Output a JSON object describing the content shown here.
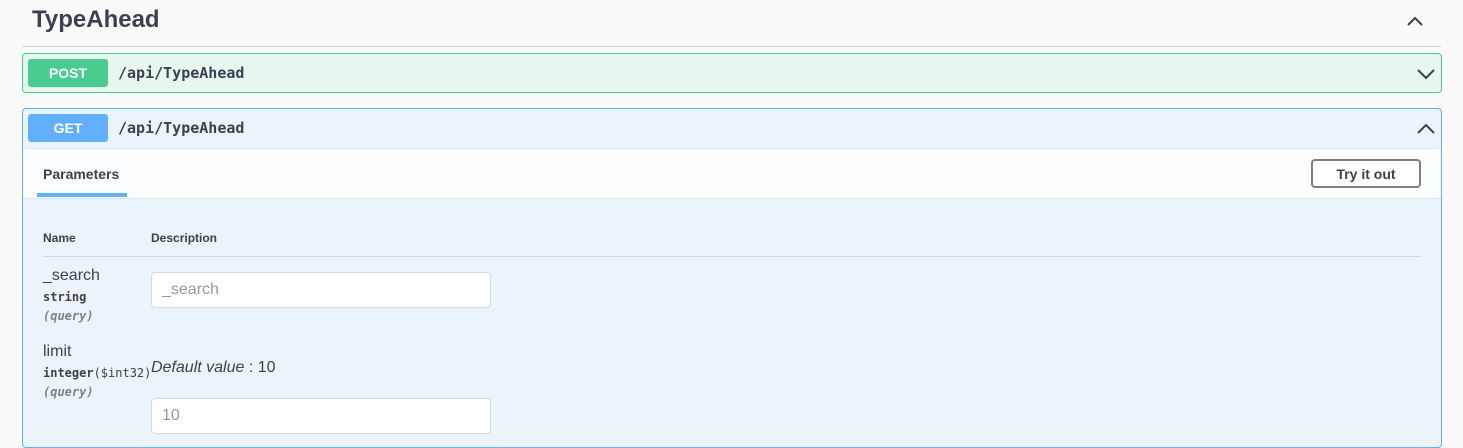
{
  "section": {
    "title": "TypeAhead"
  },
  "operations": [
    {
      "method": "POST",
      "path": "/api/TypeAhead"
    },
    {
      "method": "GET",
      "path": "/api/TypeAhead"
    }
  ],
  "panel": {
    "tab_label": "Parameters",
    "try_label": "Try it out",
    "col_name": "Name",
    "col_description": "Description"
  },
  "params": [
    {
      "name": "_search",
      "type": "string",
      "in": "(query)",
      "placeholder": "_search"
    },
    {
      "name": "limit",
      "type": "integer",
      "format": "($int32)",
      "in": "(query)",
      "default_label": "Default value",
      "default_sep": " : ",
      "default_value": "10",
      "placeholder": "10"
    }
  ],
  "colors": {
    "post": "#49cc90",
    "get": "#61affe",
    "text": "#3b4151"
  }
}
